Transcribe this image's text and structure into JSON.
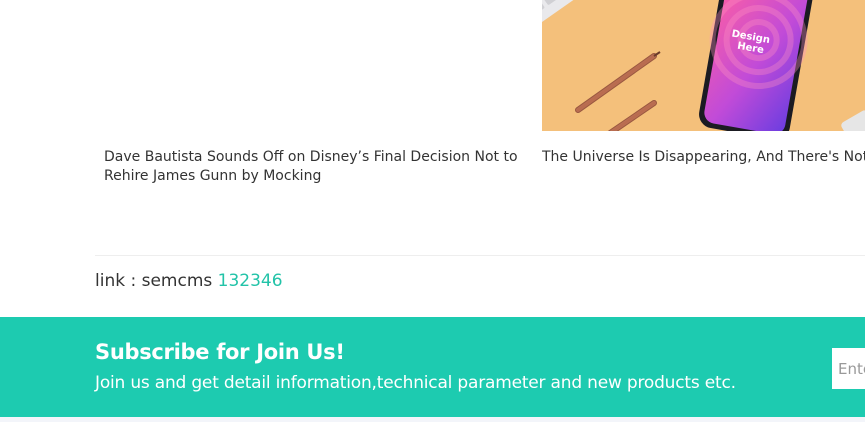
{
  "news": [
    {
      "title": "Dave Bautista Sounds Off on Disney’s Final Decision Not to Rehire James Gunn by Mocking"
    },
    {
      "title": "The Universe Is Disappearing, And There's Nothing We Can Do To Stop It",
      "image_phone_text": "Design Here"
    }
  ],
  "link": {
    "label": "link : semcms",
    "value": "132346"
  },
  "subscribe": {
    "title": "Subscribe for Join Us!",
    "text": "Join us and get detail information,technical parameter and new products etc.",
    "input_placeholder": "Enter your email"
  },
  "colors": {
    "accent": "#1dcbb0",
    "link": "#22c3a8",
    "image_bg": "#f4c07b"
  }
}
